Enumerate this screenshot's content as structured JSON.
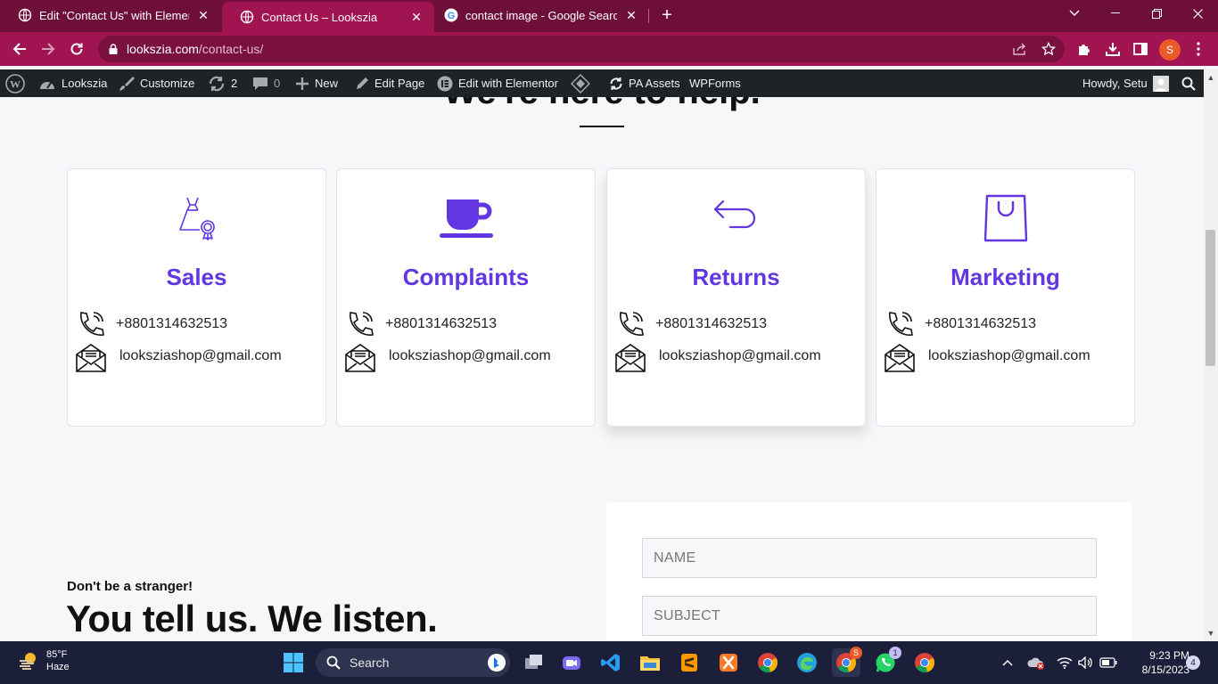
{
  "browser": {
    "tabs": [
      {
        "title": "Edit \"Contact Us\" with Elementor",
        "close": "✕",
        "active": false
      },
      {
        "title": "Contact Us – Lookszia",
        "close": "✕",
        "active": true
      },
      {
        "title": "contact image - Google Search",
        "close": "✕",
        "active": false
      }
    ],
    "new_tab": "+",
    "address": {
      "domain": "lookszia.com",
      "path": "/contact-us/"
    },
    "profile_initial": "S",
    "accent_color": "#a01452"
  },
  "admin_bar": {
    "site_name": "Lookszia",
    "customize": "Customize",
    "updates_count": "2",
    "comments_count": "0",
    "new": "New",
    "edit_page": "Edit Page",
    "edit_with_elementor": "Edit with Elementor",
    "pa_assets": "PA Assets",
    "wpforms": "WPForms",
    "howdy": "Howdy, Setu"
  },
  "page": {
    "heading_partial": "We're here to help.",
    "accent_color": "#6236e0",
    "cards": [
      {
        "icon": "dress-icon",
        "title": "Sales",
        "phone": "+8801314632513",
        "email": "looksziashop@gmail.com"
      },
      {
        "icon": "cup-icon",
        "title": "Complaints",
        "phone": "+8801314632513",
        "email": "looksziashop@gmail.com"
      },
      {
        "icon": "return-arrow-icon",
        "title": "Returns",
        "phone": "+8801314632513",
        "email": "looksziashop@gmail.com"
      },
      {
        "icon": "shopping-bag-icon",
        "title": "Marketing",
        "phone": "+8801314632513",
        "email": "looksziashop@gmail.com"
      }
    ],
    "eyebrow": "Don't be a stranger!",
    "big_title": "You tell us. We listen.",
    "form": {
      "name_placeholder": "NAME",
      "subject_placeholder": "SUBJECT"
    }
  },
  "taskbar": {
    "weather_temp": "85°F",
    "weather_desc": "Haze",
    "search_label": "Search",
    "time": "9:23 PM",
    "date": "8/15/2023",
    "notification_count": "4",
    "chrome_badge": "S",
    "whatsapp_badge": "1"
  }
}
